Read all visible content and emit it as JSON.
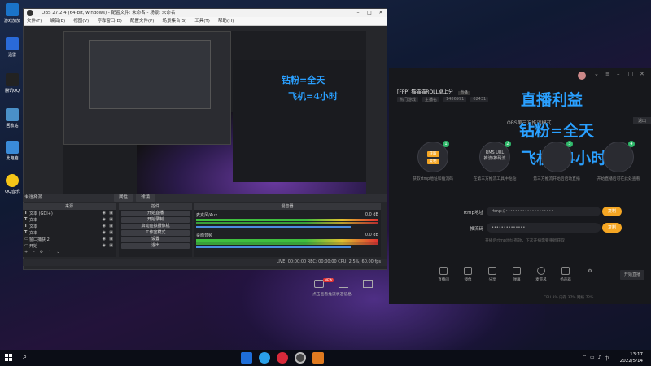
{
  "desktop_icons": [
    {
      "label": "游戏加加",
      "icon": "game-plus-icon",
      "color": "#1a73c8"
    },
    {
      "label": "迅雷",
      "icon": "xunlei-icon",
      "color": "#2a6ad8"
    },
    {
      "label": "腾讯QQ",
      "icon": "qq-icon",
      "color": "#222222"
    },
    {
      "label": "回收站",
      "icon": "recycle-bin-icon",
      "color": "#4a90c8"
    },
    {
      "label": "此电脑",
      "icon": "this-pc-icon",
      "color": "#3a8ad8"
    },
    {
      "label": "QQ音乐",
      "icon": "qq-music-icon",
      "color": "#f5c518"
    }
  ],
  "obs": {
    "title": "OBS 27.2.4 (64-bit, windows) - 配置文件: 未命名 - 场景: 未命名",
    "menu": [
      "文件(F)",
      "编辑(E)",
      "视图(V)",
      "停靠窗口(D)",
      "配置文件(P)",
      "场景集合(S)",
      "工具(T)",
      "帮助(H)"
    ],
    "dock_title": "未选择源",
    "dock_tabs": [
      "属性",
      "滤镜"
    ],
    "sources_header": "来源",
    "sources": [
      {
        "type": "T",
        "name": "文本 (GDI+)"
      },
      {
        "type": "T",
        "name": "文本"
      },
      {
        "type": "T",
        "name": "文本"
      },
      {
        "type": "T",
        "name": "文本"
      },
      {
        "type": "▭",
        "name": "窗口捕获 2"
      },
      {
        "type": "▭",
        "name": "开始"
      }
    ],
    "controls_header": "控件",
    "controls": [
      "开始直播",
      "开始录制",
      "启动虚拟摄像机",
      "工作室模式",
      "设置",
      "退出"
    ],
    "mixer_header": "混音器",
    "mixer_tracks": [
      {
        "name": "麦克风/Aux",
        "db": "0.0 dB"
      },
      {
        "name": "桌面音频",
        "db": "0.0 dB"
      }
    ],
    "status": "LIVE: 00:00:00   REC: 00:00:00   CPU: 2.5%, 60.00 fps",
    "preview_text": [
      "钻粉=全天",
      "飞机=4小时"
    ]
  },
  "live_tool": {
    "room_title": "[FPP] 猫猫猫ROLL卓上分",
    "room_badge": "直播",
    "room_meta": [
      "热门游戏",
      "主播名",
      "1486991",
      "02431"
    ],
    "overlay_lines": [
      "直播利益",
      "钻粉=全天",
      "飞机=4小时"
    ],
    "mode_title": "OBS第三方推流模式",
    "exit_label": "退出",
    "steps": [
      {
        "num": "1",
        "inner": [
          "获取",
          "复制"
        ],
        "desc": "获取rtmp地址和推流码"
      },
      {
        "num": "2",
        "inner": [
          "RMS URL",
          "推流/推码流"
        ],
        "desc": "在第三方推流工具中粘贴"
      },
      {
        "num": "3",
        "inner": [
          ""
        ],
        "desc": "第三方推流开始后启动直播"
      },
      {
        "num": "4",
        "inner": [
          ""
        ],
        "desc": "开始直播后可在此处查看"
      }
    ],
    "rtmp_label": "rtmp地址",
    "rtmp_value": "rtmp://••••••••••••••••••••",
    "key_label": "推流码",
    "key_value": "••••••••••••••",
    "copy_label": "复制",
    "hint": "开播后rtmp地址有效，下次开播需要重新获取",
    "tools": [
      "直播间",
      "镜像",
      "分享",
      "弹幕",
      "麦克风",
      "扬声器"
    ],
    "start_label": "开始直播",
    "footer": "CPU 3%   内存 37%   网络 72%"
  },
  "tray_popup": {
    "badge": "NEW",
    "notification": "点击查看推流状态信息"
  },
  "taskbar": {
    "time": "13:17",
    "date": "2022/5/14"
  }
}
